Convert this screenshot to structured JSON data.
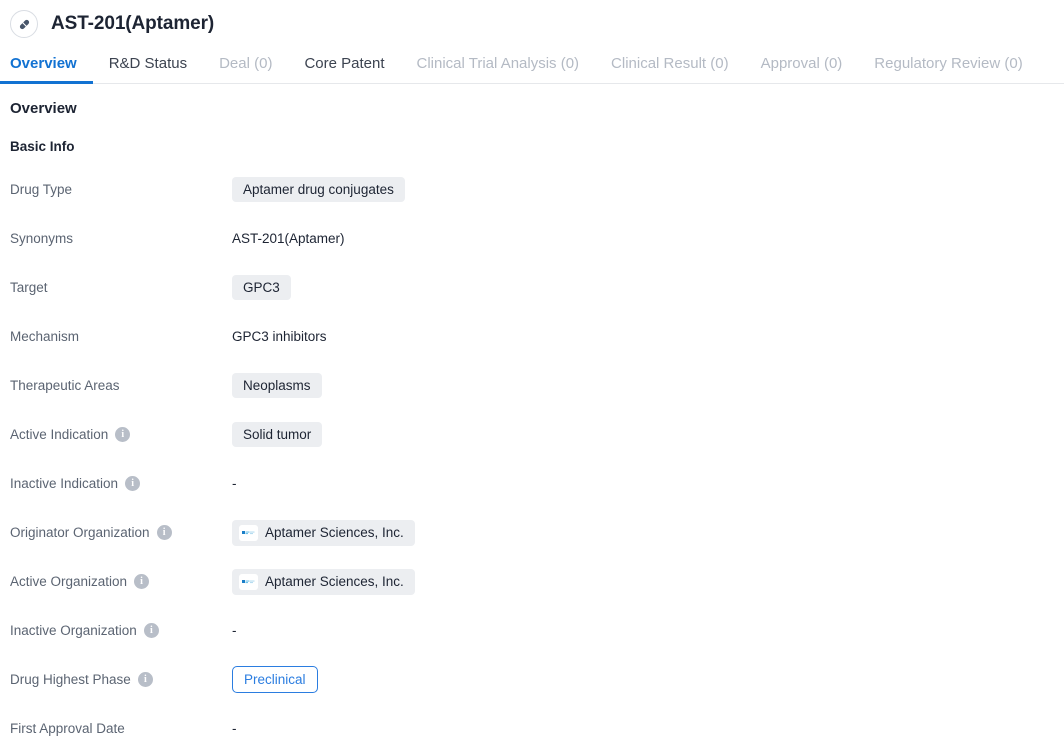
{
  "header": {
    "icon": "pill-capsule-icon",
    "title": "AST-201(Aptamer)"
  },
  "tabs": [
    {
      "label": "Overview",
      "state": "active"
    },
    {
      "label": "R&D Status",
      "state": "normal"
    },
    {
      "label": "Deal (0)",
      "state": "muted"
    },
    {
      "label": "Core Patent",
      "state": "normal"
    },
    {
      "label": "Clinical Trial Analysis (0)",
      "state": "muted"
    },
    {
      "label": "Clinical Result (0)",
      "state": "muted"
    },
    {
      "label": "Approval (0)",
      "state": "muted"
    },
    {
      "label": "Regulatory Review (0)",
      "state": "muted"
    }
  ],
  "overview": {
    "section_title": "Overview",
    "subsection_title": "Basic Info",
    "rows": [
      {
        "label": "Drug Type",
        "info": false,
        "type": "chip",
        "value": "Aptamer drug conjugates"
      },
      {
        "label": "Synonyms",
        "info": false,
        "type": "text",
        "value": "AST-201(Aptamer)"
      },
      {
        "label": "Target",
        "info": false,
        "type": "chip",
        "value": "GPC3"
      },
      {
        "label": "Mechanism",
        "info": false,
        "type": "text",
        "value": "GPC3 inhibitors"
      },
      {
        "label": "Therapeutic Areas",
        "info": false,
        "type": "chip",
        "value": "Neoplasms"
      },
      {
        "label": "Active Indication",
        "info": true,
        "type": "chip",
        "value": "Solid tumor"
      },
      {
        "label": "Inactive Indication",
        "info": true,
        "type": "dash",
        "value": "-"
      },
      {
        "label": "Originator Organization",
        "info": true,
        "type": "orgchip",
        "value": "Aptamer Sciences, Inc."
      },
      {
        "label": "Active Organization",
        "info": true,
        "type": "orgchip",
        "value": "Aptamer Sciences, Inc."
      },
      {
        "label": "Inactive Organization",
        "info": true,
        "type": "dash",
        "value": "-"
      },
      {
        "label": "Drug Highest Phase",
        "info": true,
        "type": "pill",
        "value": "Preclinical"
      },
      {
        "label": "First Approval Date",
        "info": false,
        "type": "dash",
        "value": "-"
      }
    ]
  },
  "icons": {
    "info": "i",
    "org_logo": "company-logo-icon"
  },
  "colors": {
    "accent": "#1272d2",
    "pill_border": "#2b7de0",
    "chip_bg": "#eceef1",
    "label_text": "#5b6472",
    "value_text": "#1d2433",
    "muted_tab": "#b4bac4",
    "divider": "#e6e8eb"
  }
}
